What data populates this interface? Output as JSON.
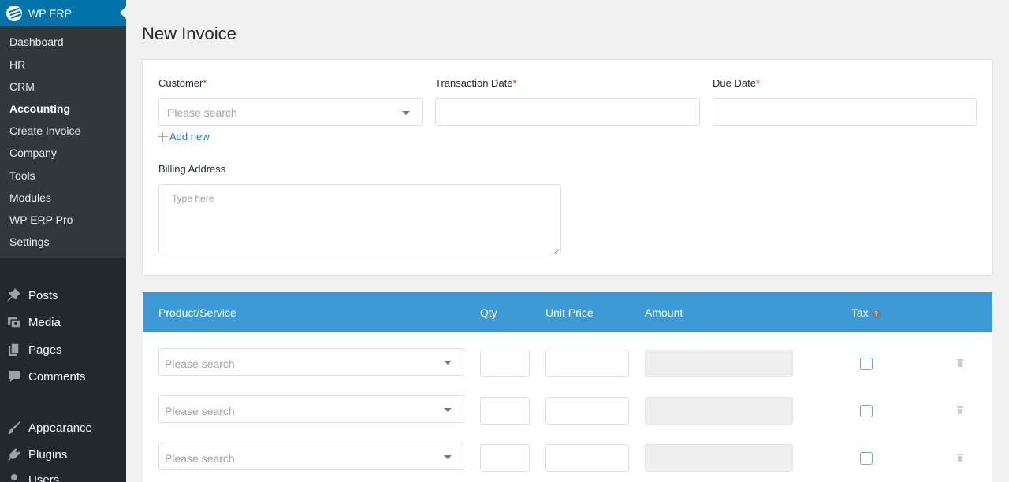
{
  "sidebar": {
    "brand": "WP ERP",
    "submenu": [
      "Dashboard",
      "HR",
      "CRM",
      "Accounting",
      "Create Invoice",
      "Company",
      "Tools",
      "Modules",
      "WP ERP Pro",
      "Settings"
    ],
    "active_submenu": "Accounting",
    "menu": [
      {
        "label": "Posts",
        "icon": "pin-icon"
      },
      {
        "label": "Media",
        "icon": "media-icon"
      },
      {
        "label": "Pages",
        "icon": "pages-icon"
      },
      {
        "label": "Comments",
        "icon": "comments-icon"
      },
      {
        "label": "Appearance",
        "icon": "brush-icon"
      },
      {
        "label": "Plugins",
        "icon": "plug-icon"
      },
      {
        "label": "Users",
        "icon": "users-icon"
      }
    ]
  },
  "page": {
    "title": "New Invoice"
  },
  "form": {
    "customer_label": "Customer",
    "customer_placeholder": "Please search",
    "add_new": "Add new",
    "transaction_date_label": "Transaction Date",
    "due_date_label": "Due Date",
    "required_mark": "*",
    "billing_address_label": "Billing Address",
    "billing_address_placeholder": "Type here"
  },
  "table": {
    "headers": {
      "product": "Product/Service",
      "qty": "Qty",
      "unit_price": "Unit Price",
      "amount": "Amount",
      "tax": "Tax",
      "tax_help": "?"
    },
    "rows": [
      {
        "product_placeholder": "Please search"
      },
      {
        "product_placeholder": "Please search"
      },
      {
        "product_placeholder": "Please search"
      }
    ]
  },
  "colors": {
    "sidebar_bg": "#23282d",
    "submenu_bg": "#32373c",
    "brand_blue": "#0073aa",
    "table_header": "#3d9ad6",
    "required": "#e2401c",
    "link": "#1a7dbd"
  }
}
